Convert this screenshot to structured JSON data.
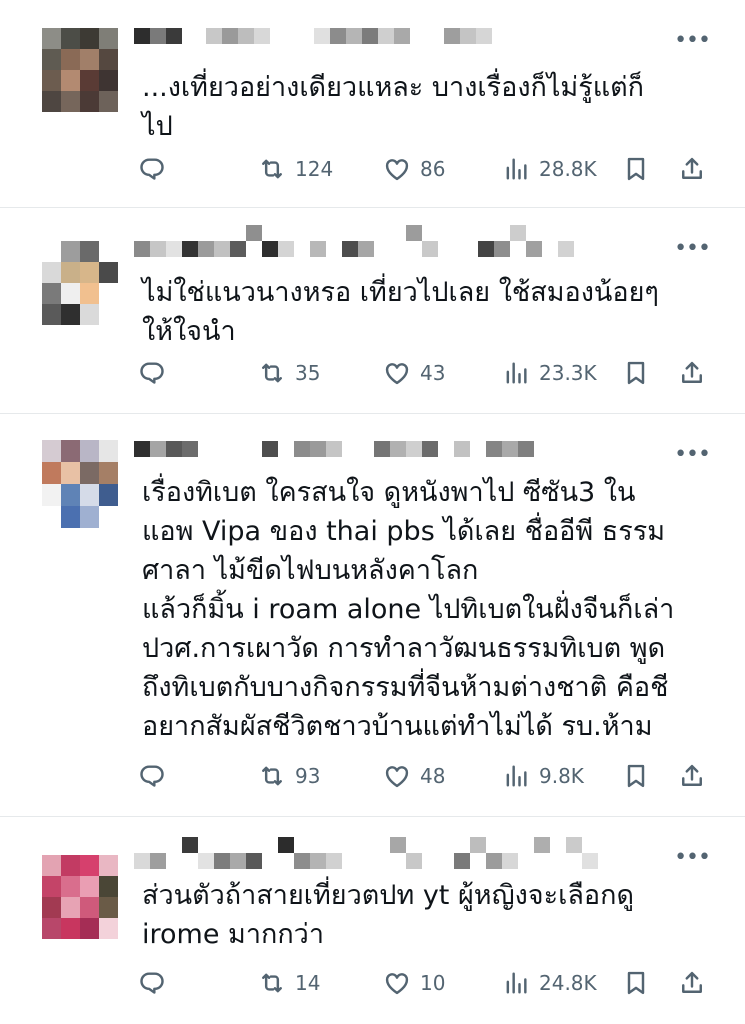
{
  "posts": [
    {
      "text": "...งเที่ยวอย่างเดียวแหละ บางเรื่องก็ไม่รู้แต่ก็\nไป",
      "retweets": "124",
      "likes": "86",
      "views": "28.8K"
    },
    {
      "text": "ไม่ใช่แนวนางหรอ เที่ยวไปเลย ใช้สมองน้อยๆ\nให้ใจนำ",
      "retweets": "35",
      "likes": "43",
      "views": "23.3K"
    },
    {
      "text": "เรื่องทิเบต ใครสนใจ ดูหนังพาไป ซีซัน3 ใน\nแอพ Vipa ของ thai pbs ได้เลย ชื่ออีพี ธรรม\nศาลา ไม้ขีดไฟบนหลังคาโลก\nแล้วก็มิ้น i roam alone ไปทิเบตในฝั่งจีนก็เล่า\nปวศ.การเผาวัด การทำลาวัฒนธรรมทิเบต พูด\nถึงทิเบตกับบางกิจกรรมที่จีนห้ามต่างชาติ คือชี\nอยากสัมผัสชีวิตชาวบ้านแต่ทำไม่ได้ รบ.ห้าม",
      "retweets": "93",
      "likes": "48",
      "views": "9.8K"
    },
    {
      "text": "ส่วนตัวถ้าสายเที่ยวตปท yt ผู้หญิงจะเลือกดู\nirome มากกว่า",
      "retweets": "14",
      "likes": "10",
      "views": "24.8K"
    }
  ],
  "icons": {
    "more": "more-options-icon",
    "reply": "reply-icon",
    "retweet": "retweet-icon",
    "like": "like-icon",
    "views": "views-icon",
    "bookmark": "bookmark-icon",
    "share": "share-icon"
  },
  "colors": {
    "text": "#0f1419",
    "secondary": "#536471",
    "divider": "#e6e9eb"
  }
}
